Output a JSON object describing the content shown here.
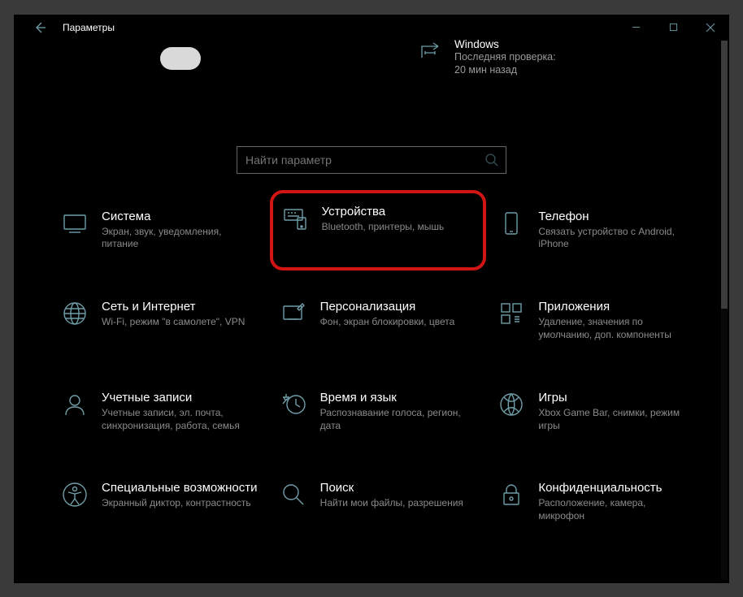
{
  "window": {
    "title": "Параметры"
  },
  "update": {
    "line1": "Windows",
    "line2": "Последняя проверка:",
    "line3": "20 мин назад"
  },
  "search": {
    "placeholder": "Найти параметр"
  },
  "tiles": [
    {
      "title": "Система",
      "desc": "Экран, звук, уведомления, питание"
    },
    {
      "title": "Устройства",
      "desc": "Bluetooth, принтеры, мышь"
    },
    {
      "title": "Телефон",
      "desc": "Связать устройство с Android, iPhone"
    },
    {
      "title": "Сеть и Интернет",
      "desc": "Wi-Fi, режим \"в самолете\", VPN"
    },
    {
      "title": "Персонализация",
      "desc": "Фон, экран блокировки, цвета"
    },
    {
      "title": "Приложения",
      "desc": "Удаление, значения по умолчанию, доп. компоненты"
    },
    {
      "title": "Учетные записи",
      "desc": "Учетные записи, эл. почта, синхронизация, работа, семья"
    },
    {
      "title": "Время и язык",
      "desc": "Распознавание голоса, регион, дата"
    },
    {
      "title": "Игры",
      "desc": "Xbox Game Bar, снимки, режим игры"
    },
    {
      "title": "Специальные возможности",
      "desc": "Экранный диктор, контрастность"
    },
    {
      "title": "Поиск",
      "desc": "Найти мои файлы, разрешения"
    },
    {
      "title": "Конфиденциальность",
      "desc": "Расположение, камера, микрофон"
    }
  ]
}
